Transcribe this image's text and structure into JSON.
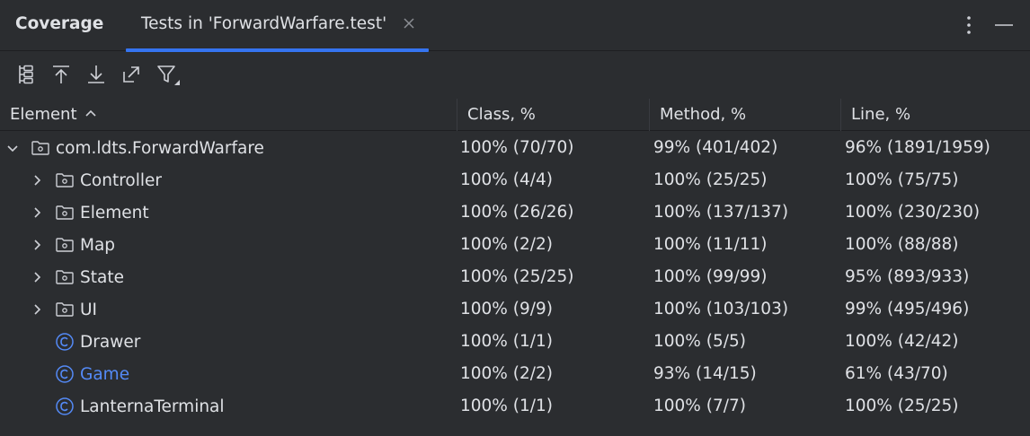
{
  "header": {
    "title": "Coverage",
    "active_tab": "Tests in 'ForwardWarfare.test'",
    "close_icon": "close-icon",
    "options_icon": "kebab-menu-icon",
    "minimize_icon": "minimize-icon",
    "accent": "#3574f0"
  },
  "toolbar": {
    "buttons": [
      {
        "name": "flatten-packages-icon"
      },
      {
        "name": "collapse-up-icon"
      },
      {
        "name": "expand-down-icon"
      },
      {
        "name": "generate-report-icon"
      },
      {
        "name": "filter-icon"
      }
    ]
  },
  "table": {
    "columns": [
      "Element",
      "Class, %",
      "Method, %",
      "Line, %"
    ],
    "sort": "ascending",
    "rows": [
      {
        "name": "com.ldts.ForwardWarfare",
        "type": "package",
        "expander": "expanded",
        "class": "100% (70/70)",
        "method": "99% (401/402)",
        "line": "96% (1891/1959)"
      },
      {
        "name": "Controller",
        "type": "package",
        "expander": "collapsed",
        "class": "100% (4/4)",
        "method": "100% (25/25)",
        "line": "100% (75/75)"
      },
      {
        "name": "Element",
        "type": "package",
        "expander": "collapsed",
        "class": "100% (26/26)",
        "method": "100% (137/137)",
        "line": "100% (230/230)"
      },
      {
        "name": "Map",
        "type": "package",
        "expander": "collapsed",
        "class": "100% (2/2)",
        "method": "100% (11/11)",
        "line": "100% (88/88)"
      },
      {
        "name": "State",
        "type": "package",
        "expander": "collapsed",
        "class": "100% (25/25)",
        "method": "100% (99/99)",
        "line": "95% (893/933)"
      },
      {
        "name": "UI",
        "type": "package",
        "expander": "collapsed",
        "class": "100% (9/9)",
        "method": "100% (103/103)",
        "line": "99% (495/496)"
      },
      {
        "name": "Drawer",
        "type": "class",
        "expander": "none",
        "class": "100% (1/1)",
        "method": "100% (5/5)",
        "line": "100% (42/42)"
      },
      {
        "name": "Game",
        "type": "class",
        "expander": "none",
        "highlight": true,
        "class": "100% (2/2)",
        "method": "93% (14/15)",
        "line": "61% (43/70)"
      },
      {
        "name": "LanternaTerminal",
        "type": "class",
        "expander": "none",
        "class": "100% (1/1)",
        "method": "100% (7/7)",
        "line": "100% (25/25)"
      }
    ]
  },
  "colors": {
    "background": "#2b2d30",
    "text": "#dfe1e5",
    "highlight_text": "#548af7",
    "class_icon": "#548af7"
  }
}
